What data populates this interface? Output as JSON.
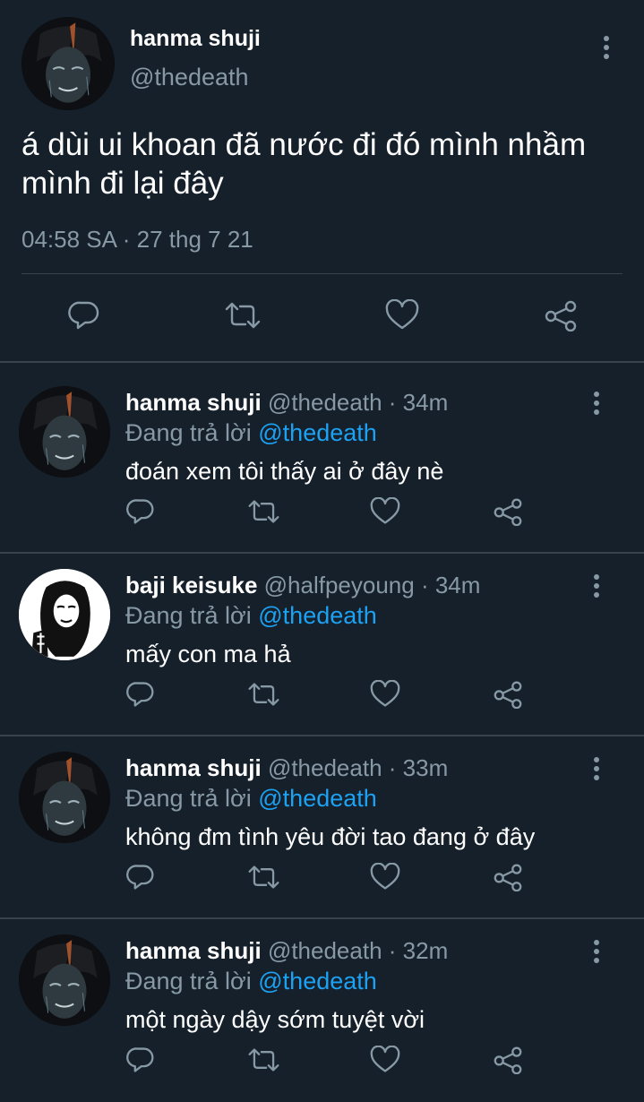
{
  "tweet": {
    "name": "hanma shuji",
    "handle": "@thedeath",
    "text": "á dùi ui khoan đã nước đi đó mình nhầm mình đi lại đây",
    "time": "04:58 SA",
    "date": "27 thg 7 21",
    "meta_sep": " · "
  },
  "icons": [
    "more-vertical-icon",
    "reply-icon",
    "retweet-icon",
    "like-icon",
    "share-icon"
  ],
  "colors": {
    "background": "#15202b",
    "secondary_text": "#8899a6",
    "mention": "#1da1f2",
    "divider": "#38444d"
  },
  "replies": [
    {
      "name": "hanma shuji",
      "handle": "@thedeath",
      "sep": " · ",
      "time": "34m",
      "replying_label": "Đang trả lời ",
      "replying_to": "@thedeath",
      "text": "đoán xem tôi thấy ai ở đây nè"
    },
    {
      "name": "baji keisuke",
      "handle": "@halfpeyoung",
      "sep": " · ",
      "time": "34m",
      "replying_label": "Đang trả lời ",
      "replying_to": "@thedeath",
      "text": "mấy con ma hả"
    },
    {
      "name": "hanma shuji",
      "handle": "@thedeath",
      "sep": " · ",
      "time": "33m",
      "replying_label": "Đang trả lời ",
      "replying_to": "@thedeath",
      "text": "không đm tình yêu đời tao đang ở đây"
    },
    {
      "name": "hanma shuji",
      "handle": "@thedeath",
      "sep": " · ",
      "time": "32m",
      "replying_label": "Đang trả lời ",
      "replying_to": "@thedeath",
      "text": "một ngày dậy sớm tuyệt vời"
    }
  ]
}
